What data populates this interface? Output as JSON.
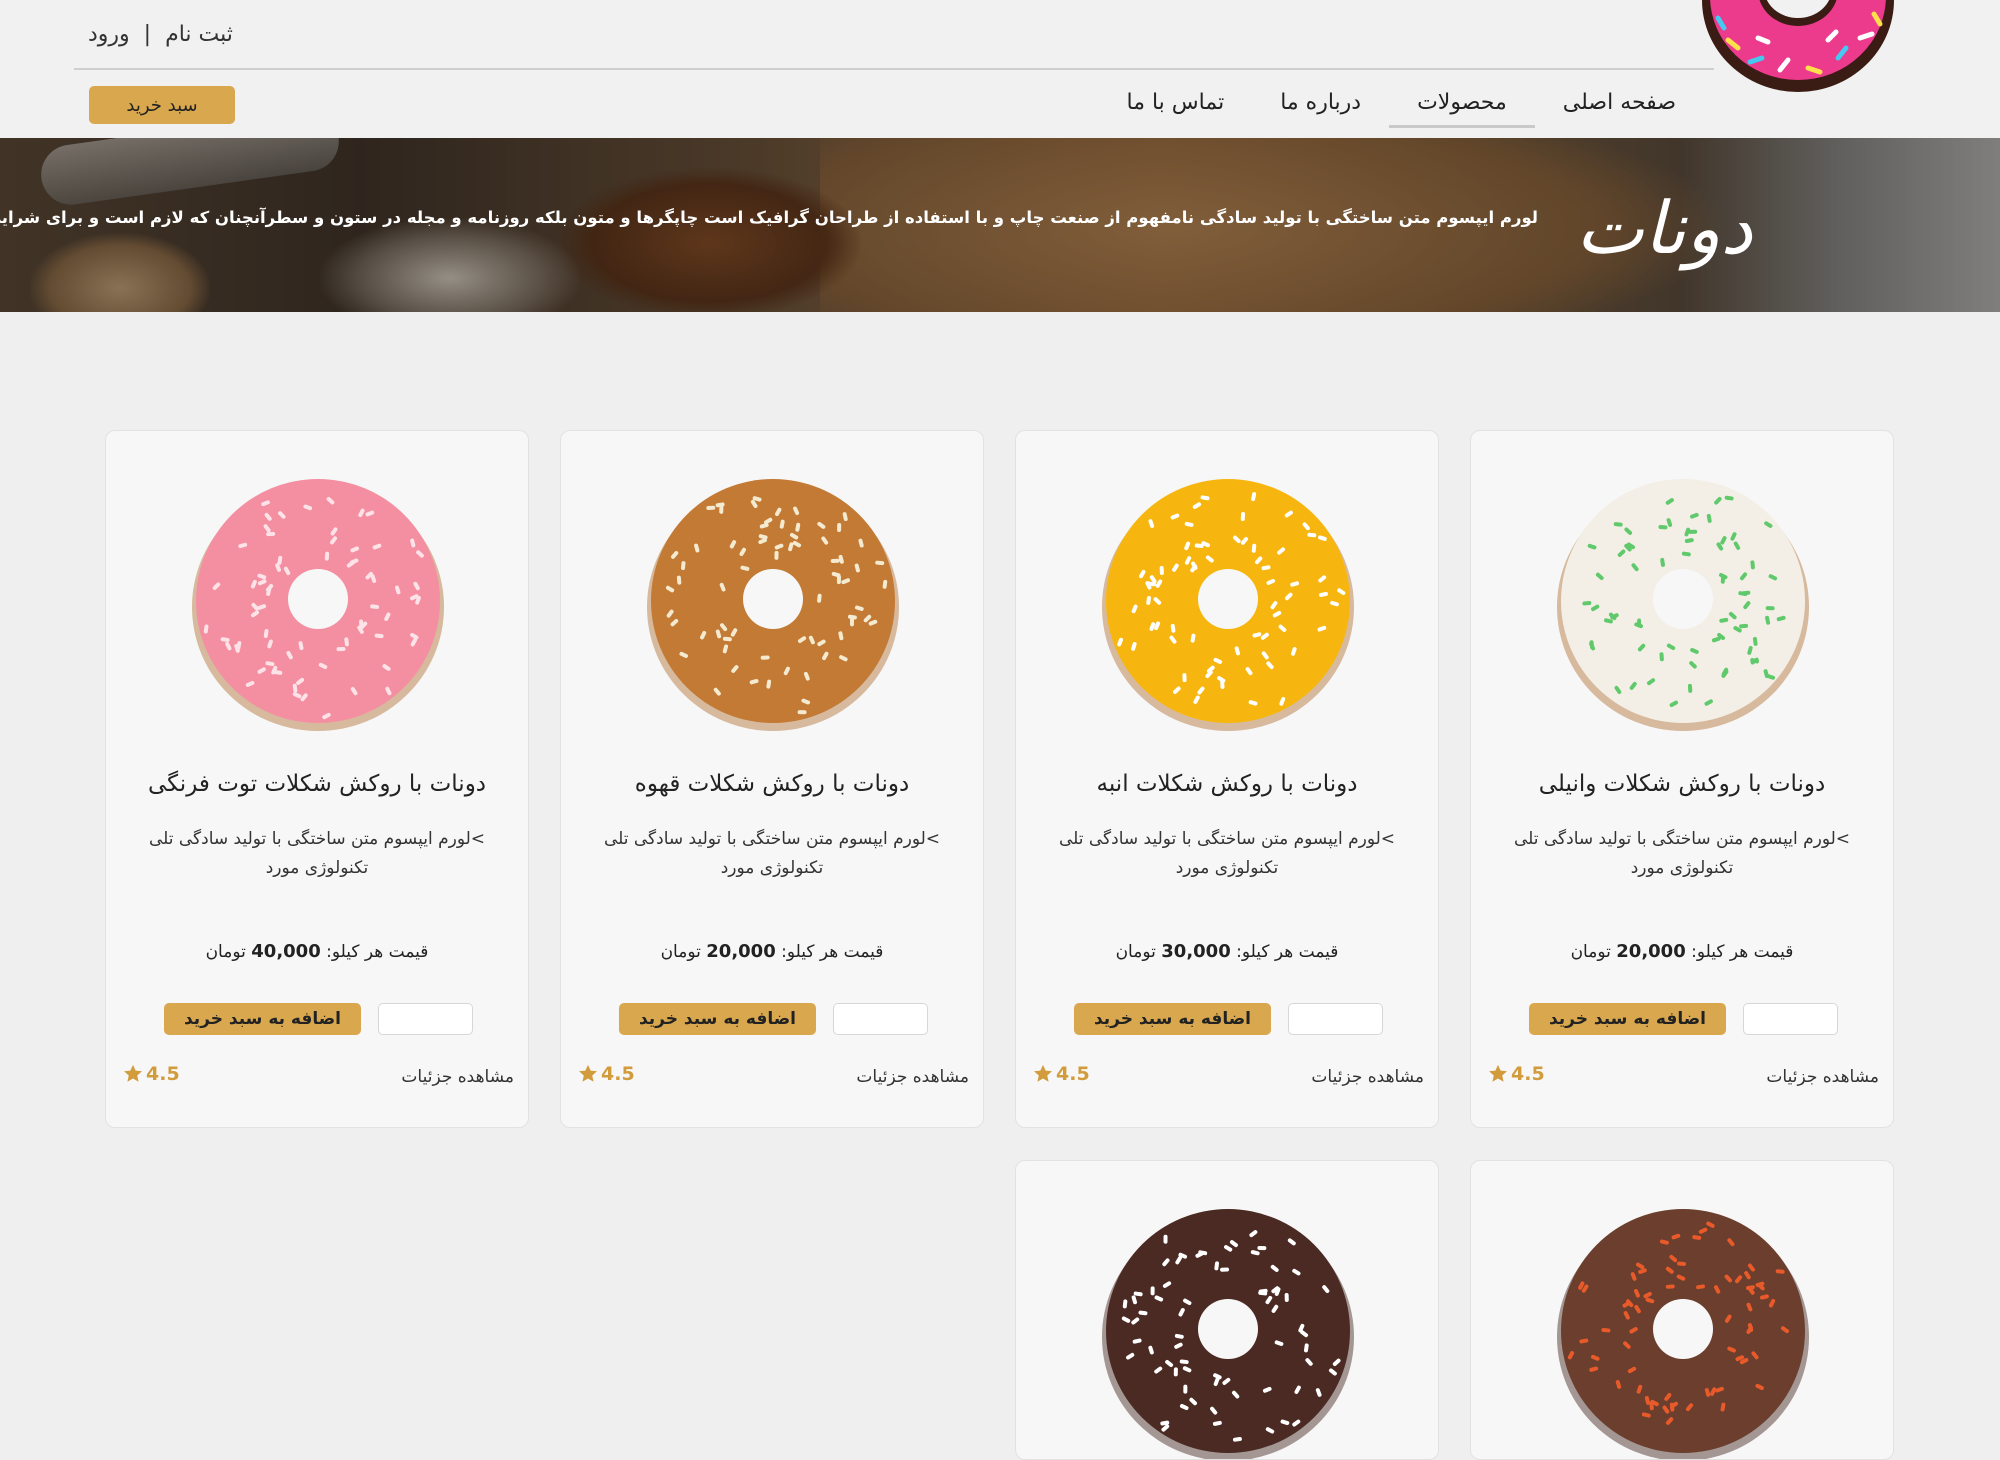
{
  "header": {
    "signup_label": "ثبت نام",
    "separator": "|",
    "login_label": "ورود",
    "cart_label": "سبد خرید",
    "nav": [
      {
        "label": "صفحه اصلی"
      },
      {
        "label": "محصولات",
        "active": true
      },
      {
        "label": "درباره ما"
      },
      {
        "label": "تماس با ما"
      }
    ]
  },
  "hero": {
    "title": "دونات",
    "text": "لورم ایپسوم متن ساختگی با تولید سادگی نامفهوم از صنعت چاپ و با استفاده از طراحان گرافیک است چاپگرها و متون بلکه روزنامه و مجله در ستون و سطرآنچنان که لازم است و برای شرایط فعلی تکنولوژی مورد"
  },
  "products": [
    {
      "title": "دونات با روکش شکلات وانیلی",
      "desc": ">لورم ایپسوم متن ساختگی با تولید سادگی تلی تکنولوژی مورد",
      "price_prefix": "قیمت هر کیلو:",
      "price": "20,000",
      "currency": "تومان",
      "add_label": "اضافه به سبد خرید",
      "details_label": "مشاهده جزئیات",
      "rating": "4.5",
      "colors": {
        "glaze": "#f3efe6",
        "topping": "#5fc96b"
      }
    },
    {
      "title": "دونات با روکش شکلات انبه",
      "desc": ">لورم ایپسوم متن ساختگی با تولید سادگی تلی تکنولوژی مورد",
      "price_prefix": "قیمت هر کیلو:",
      "price": "30,000",
      "currency": "تومان",
      "add_label": "اضافه به سبد خرید",
      "details_label": "مشاهده جزئیات",
      "rating": "4.5",
      "colors": {
        "glaze": "#f7b60f",
        "topping": "#ffffff"
      }
    },
    {
      "title": "دونات با روکش شکلات قهوه",
      "desc": ">لورم ایپسوم متن ساختگی با تولید سادگی تلی تکنولوژی مورد",
      "price_prefix": "قیمت هر کیلو:",
      "price": "20,000",
      "currency": "تومان",
      "add_label": "اضافه به سبد خرید",
      "details_label": "مشاهده جزئیات",
      "rating": "4.5",
      "colors": {
        "glaze": "#c27a35",
        "topping": "#f4ead0"
      }
    },
    {
      "title": "دونات با روکش شکلات توت فرنگی",
      "desc": ">لورم ایپسوم متن ساختگی با تولید سادگی تلی تکنولوژی مورد",
      "price_prefix": "قیمت هر کیلو:",
      "price": "40,000",
      "currency": "تومان",
      "add_label": "اضافه به سبد خرید",
      "details_label": "مشاهده جزئیات",
      "rating": "4.5",
      "colors": {
        "glaze": "#f48fa2",
        "topping": "#fde3e8"
      }
    },
    {
      "title": "",
      "colors": {
        "glaze": "#6b3e2e",
        "topping": "#e85a2a"
      }
    },
    {
      "title": "",
      "colors": {
        "glaze": "#4a2a22",
        "topping": "#ffffff"
      }
    }
  ],
  "theme": {
    "accent": "#d9a84e",
    "page_bg": "#efefef",
    "card_bg": "#f7f7f7",
    "rating_color": "#d29c3c"
  }
}
